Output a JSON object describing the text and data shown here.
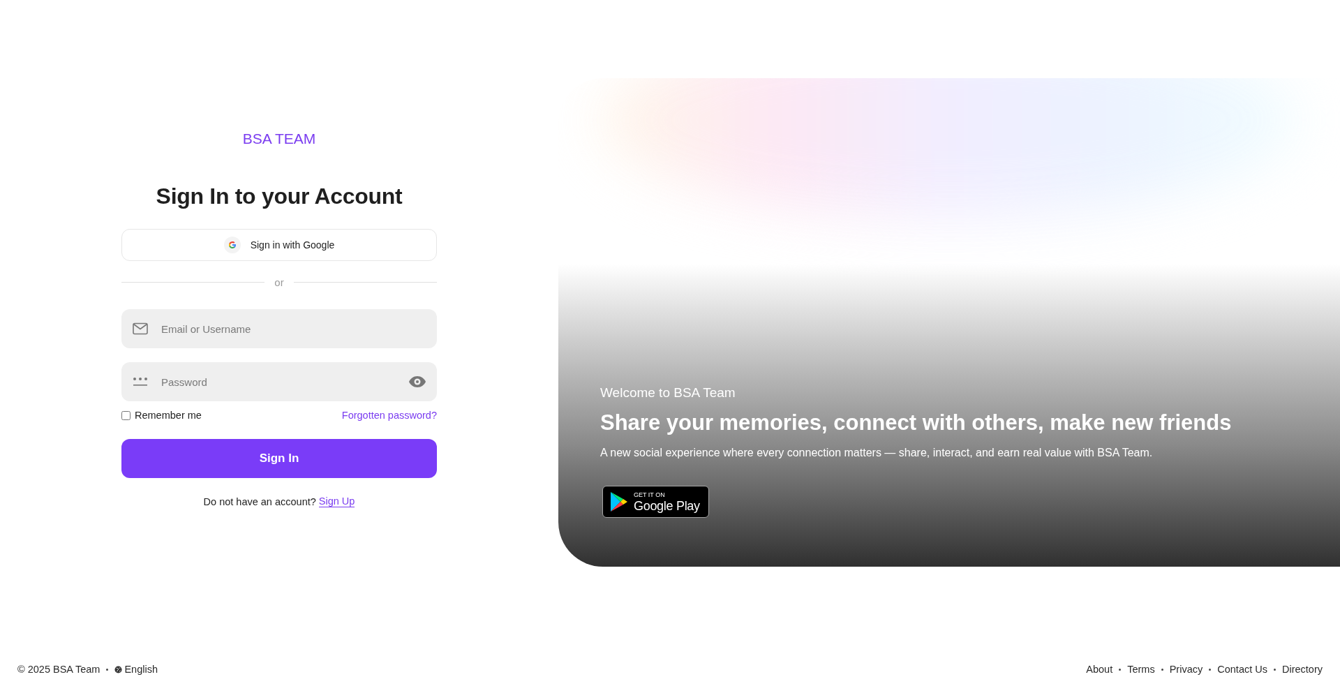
{
  "brand": "BSA TEAM",
  "title": "Sign In to your Account",
  "google_button": "Sign in with Google",
  "divider": "or",
  "email_field": {
    "placeholder": "Email or Username"
  },
  "password_field": {
    "placeholder": "Password"
  },
  "remember": {
    "label": "Remember me",
    "checked": false
  },
  "forgot_link": "Forgotten password?",
  "submit_button": "Sign In",
  "signup": {
    "text": "Do not have an account?",
    "link": "Sign Up"
  },
  "hero": {
    "eyebrow": "Welcome to BSA Team",
    "headline": "Share your memories, connect with others, make new friends",
    "description": "A new social experience where every connection matters — share, interact, and earn real value with BSA Team.",
    "store_badge": {
      "top": "GET IT ON",
      "bottom": "Google Play"
    }
  },
  "footer": {
    "copyright": "© 2025 BSA Team",
    "language": "English",
    "links": [
      "About",
      "Terms",
      "Privacy",
      "Contact Us",
      "Directory"
    ]
  }
}
